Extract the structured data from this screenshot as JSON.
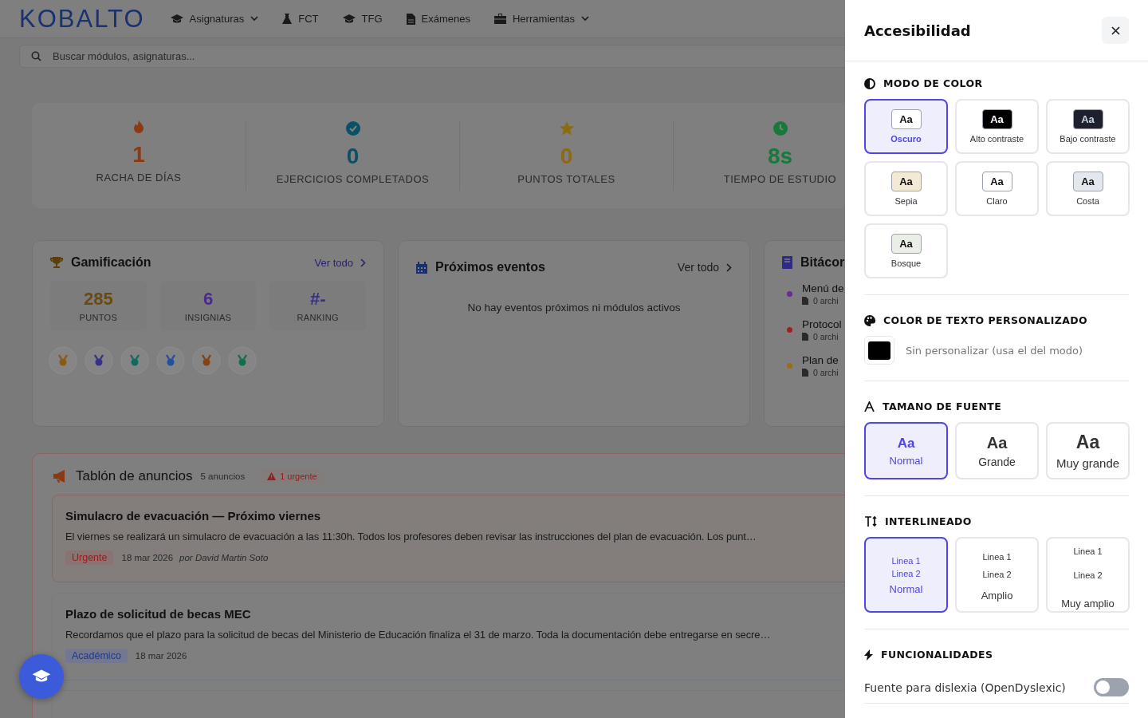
{
  "nav": {
    "logo": "KOBALTO",
    "items": [
      {
        "label": "Asignaturas",
        "kind": "cap",
        "dropdown": true
      },
      {
        "label": "FCT",
        "kind": "flask",
        "dropdown": false
      },
      {
        "label": "TFG",
        "kind": "cap",
        "dropdown": false
      },
      {
        "label": "Exámenes",
        "kind": "doc",
        "dropdown": false
      },
      {
        "label": "Herramientas",
        "kind": "toolbox",
        "dropdown": true
      }
    ]
  },
  "search": {
    "placeholder": "Buscar módulos, asignaturas..."
  },
  "stats": [
    {
      "kind": "flame",
      "value": "1",
      "label": "RACHA DE DÍAS",
      "color": "#8c3a12"
    },
    {
      "kind": "check",
      "value": "0",
      "label": "EJERCICIOS COMPLETADOS",
      "color": "#0b5064"
    },
    {
      "kind": "star",
      "value": "0",
      "label": "PUNTOS TOTALES",
      "color": "#8c6a12"
    },
    {
      "kind": "clock",
      "value": "8s",
      "label": "TIEMPO DE ESTUDIO",
      "color": "#157a3a"
    }
  ],
  "gamification": {
    "title": "Gamificación",
    "link": "Ver todo",
    "metrics": [
      {
        "value": "285",
        "label": "PUNTOS",
        "color": "#6b4a10"
      },
      {
        "value": "6",
        "label": "INSIGNIAS",
        "color": "#4a2a90"
      },
      {
        "value": "#-",
        "label": "RANKING",
        "color": "#35308a"
      }
    ],
    "badges": [
      {
        "color": "#8a5a10"
      },
      {
        "color": "#35308a"
      },
      {
        "color": "#0f6a60"
      },
      {
        "color": "#2050a0"
      },
      {
        "color": "#8a4010"
      },
      {
        "color": "#10704a"
      }
    ]
  },
  "events": {
    "title": "Próximos eventos",
    "link": "Ver todo",
    "empty": "No hay eventos próximos ni módulos activos"
  },
  "logbook": {
    "title": "Bitácor",
    "items": [
      {
        "title": "Menú de",
        "meta": "0 archi",
        "color": "#6a2a9a"
      },
      {
        "title": "Protocol",
        "meta": "0 archi",
        "color": "#a02020"
      },
      {
        "title": "Plan de",
        "meta": "0 archi",
        "color": "#a06a10"
      }
    ]
  },
  "announcements": {
    "title": "Tablón de anuncios",
    "count": "5 anuncios",
    "urgent": "1 urgente",
    "items": [
      {
        "kind": "urgent",
        "title": "Simulacro de evacuación — Próximo viernes",
        "body": "El viernes se realizará un simulacro de evacuación a las 11:30h. Todos los profesores deben revisar las instrucciones del plan de evacuación. Los punt…",
        "tag": "Urgente",
        "date": "18 mar 2026",
        "author": "por David Martin Soto"
      },
      {
        "kind": "academic",
        "title": "Plazo de solicitud de becas MEC",
        "body": "Recordamos que el plazo para la solicitud de becas del Ministerio de Educación finaliza el 31 de marzo. Toda la documentación debe entregarse en secre…",
        "tag": "Académico",
        "date": "18 mar 2026"
      },
      {
        "kind": "plain"
      }
    ]
  },
  "accessibility": {
    "title": "Accesibilidad",
    "color_mode": {
      "title": "MODO DE COLOR",
      "options": [
        {
          "sample": "Aa",
          "label": "Oscuro",
          "color": "#ffffff",
          "selected": true
        },
        {
          "sample": "Aa",
          "label": "Alto contraste",
          "color": "#000000",
          "selected": false
        },
        {
          "sample": "Aa",
          "label": "Bajo contraste",
          "color": "#1e2030",
          "selected": false
        },
        {
          "sample": "Aa",
          "label": "Sepia",
          "color": "#f3ead5",
          "selected": false
        },
        {
          "sample": "Aa",
          "label": "Claro",
          "color": "#ffffff",
          "selected": false
        },
        {
          "sample": "Aa",
          "label": "Costa",
          "color": "#e3e8ef",
          "selected": false
        },
        {
          "sample": "Aa",
          "label": "Bosque",
          "color": "#e9eee7",
          "selected": false
        }
      ]
    },
    "text_color": {
      "title": "COLOR DE TEXTO PERSONALIZADO",
      "color": "#000000",
      "label": "Sin personalizar (usa el del modo)"
    },
    "font_size": {
      "title": "TAMANO DE FUENTE",
      "options": [
        {
          "sample": "Aa",
          "label": "Normal",
          "selected": true
        },
        {
          "sample": "Aa",
          "label": "Grande",
          "selected": false
        },
        {
          "sample": "Aa",
          "label": "Muy grande",
          "selected": false
        }
      ]
    },
    "line_spacing": {
      "title": "INTERLINEADO",
      "options": [
        {
          "line1": "Linea 1",
          "line2": "Linea 2",
          "label": "Normal",
          "selected": true
        },
        {
          "line1": "Linea 1",
          "line2": "Linea 2",
          "label": "Amplio",
          "selected": false
        },
        {
          "line1": "Linea 1",
          "line2": "Linea 2",
          "label": "Muy amplio",
          "selected": false
        }
      ]
    },
    "features": {
      "title": "FUNCIONALIDADES",
      "items": [
        {
          "label": "Fuente para dislexia (OpenDyslexic)",
          "on": false
        }
      ]
    }
  }
}
